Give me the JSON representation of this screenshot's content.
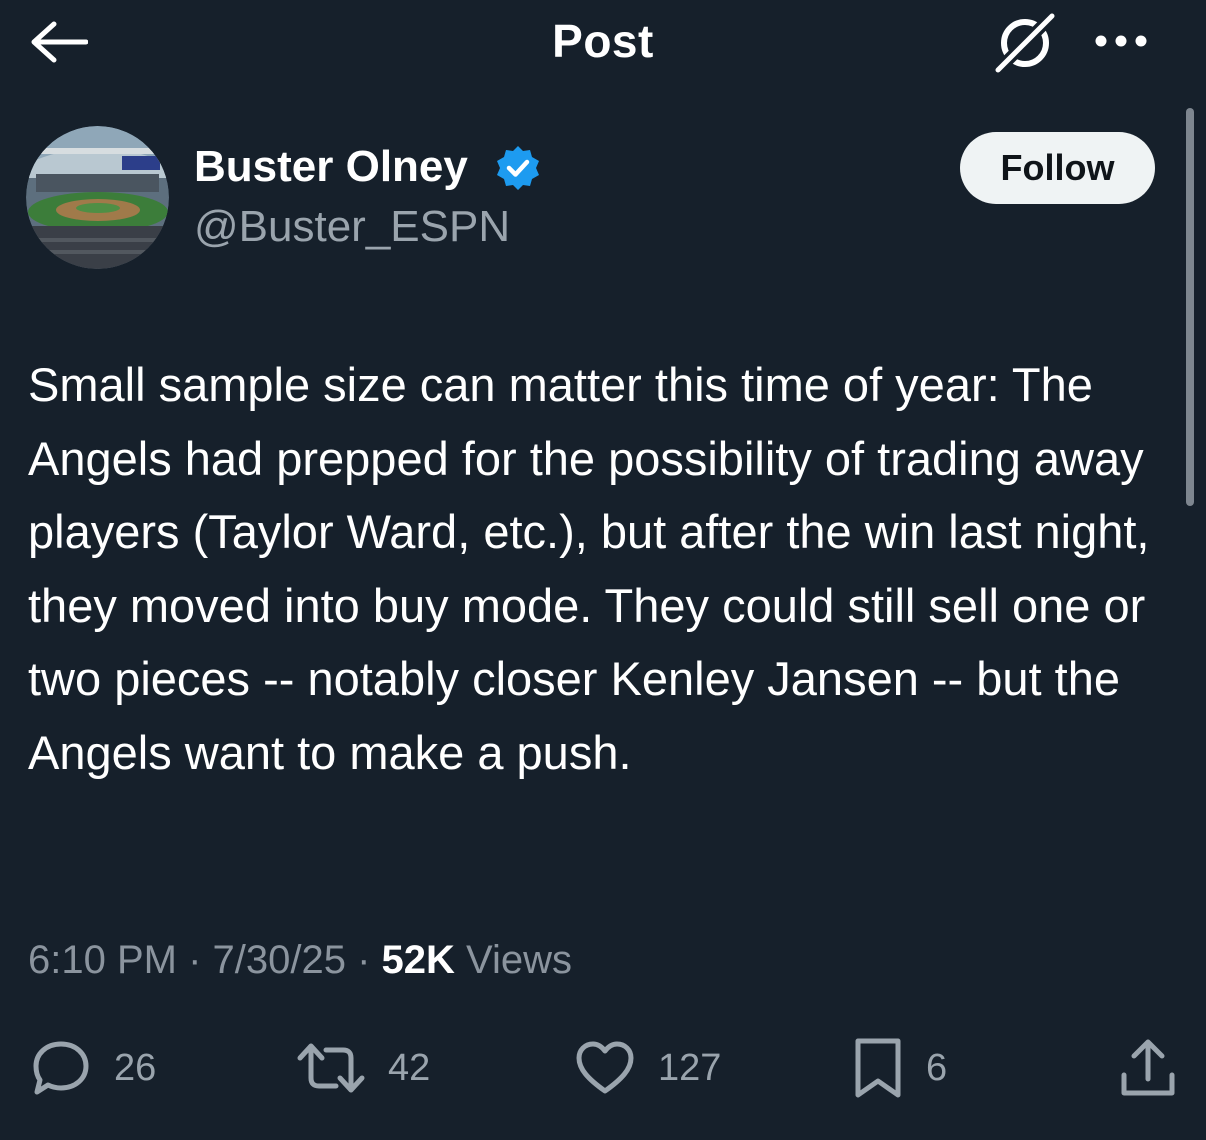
{
  "header": {
    "title": "Post"
  },
  "author": {
    "name": "Buster Olney",
    "handle": "@Buster_ESPN",
    "verified": true,
    "follow_label": "Follow"
  },
  "post": {
    "text": "Small sample size can matter this time of year: The Angels had prepped for the possibility of trading away players (Taylor Ward, etc.), but after the win last night, they moved into buy mode. They could still sell one or two pieces -- notably closer Kenley Jansen -- but the Angels want to make a push.",
    "time": "6:10 PM",
    "date": "7/30/25",
    "views_count": "52K",
    "views_label": "Views",
    "separator": " · "
  },
  "actions": {
    "replies": "26",
    "reposts": "42",
    "likes": "127",
    "bookmarks": "6"
  },
  "icons": {
    "back": "arrow-left-icon",
    "grok": "grok-icon",
    "more": "more-dots-icon",
    "verified": "verified-badge-icon",
    "reply": "reply-icon",
    "repost": "repost-icon",
    "like": "heart-icon",
    "bookmark": "bookmark-icon",
    "share": "share-icon"
  },
  "colors": {
    "background": "#16202b",
    "verified_blue": "#1d9bf0",
    "muted_text": "#8b949e",
    "follow_bg": "#eff3f4"
  }
}
